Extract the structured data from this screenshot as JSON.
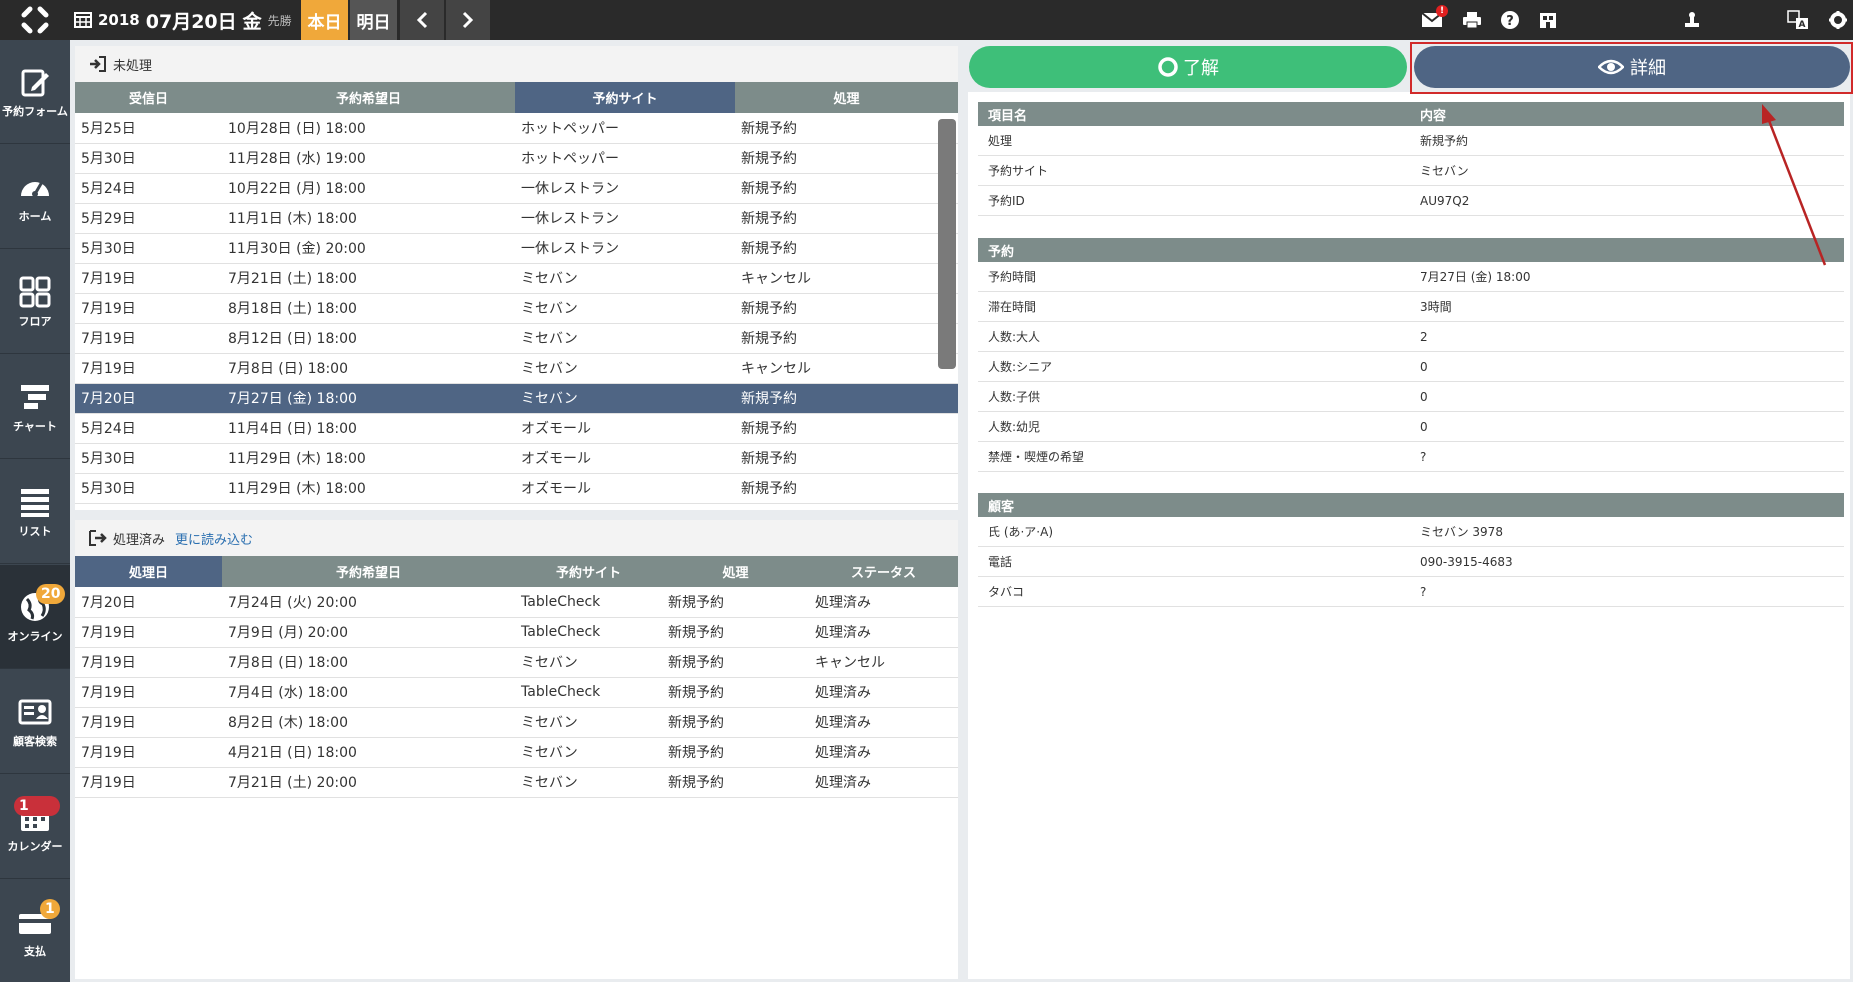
{
  "topbar": {
    "year": "2018",
    "month_day": "07月20日",
    "weekday": "金",
    "rokuyo": "先勝",
    "today_label": "本日",
    "tomorrow_label": "明日",
    "mail_badge": "!"
  },
  "sidebar": {
    "items": [
      {
        "label": "予約フォーム",
        "icon": "edit-form-icon"
      },
      {
        "label": "ホーム",
        "icon": "dashboard-icon"
      },
      {
        "label": "フロア",
        "icon": "floor-grid-icon"
      },
      {
        "label": "チャート",
        "icon": "chart-icon"
      },
      {
        "label": "リスト",
        "icon": "list-icon"
      },
      {
        "label": "オンライン",
        "icon": "globe-icon",
        "badge": "20"
      },
      {
        "label": "顧客検索",
        "icon": "customer-card-icon"
      },
      {
        "label": "カレンダー",
        "icon": "calendar-icon",
        "badge": "1"
      },
      {
        "label": "支払",
        "icon": "payment-card-icon",
        "badge": "1"
      }
    ]
  },
  "pending": {
    "title": "未処理",
    "columns": [
      "受信日",
      "予約希望日",
      "予約サイト",
      "処理"
    ],
    "rows": [
      [
        "5月25日",
        "10月28日 (日) 18:00",
        "ホットペッパー",
        "新規予約"
      ],
      [
        "5月30日",
        "11月28日 (水) 19:00",
        "ホットペッパー",
        "新規予約"
      ],
      [
        "5月24日",
        "10月22日 (月) 18:00",
        "一休レストラン",
        "新規予約"
      ],
      [
        "5月29日",
        "11月1日 (木) 18:00",
        "一休レストラン",
        "新規予約"
      ],
      [
        "5月30日",
        "11月30日 (金) 20:00",
        "一休レストラン",
        "新規予約"
      ],
      [
        "7月19日",
        "7月21日 (土) 18:00",
        "ミセバン",
        "キャンセル"
      ],
      [
        "7月19日",
        "8月18日 (土) 18:00",
        "ミセバン",
        "新規予約"
      ],
      [
        "7月19日",
        "8月12日 (日) 18:00",
        "ミセバン",
        "新規予約"
      ],
      [
        "7月19日",
        "7月8日 (日) 18:00",
        "ミセバン",
        "キャンセル"
      ],
      [
        "7月20日",
        "7月27日 (金) 18:00",
        "ミセバン",
        "新規予約"
      ],
      [
        "5月24日",
        "11月4日 (日) 18:00",
        "オズモール",
        "新規予約"
      ],
      [
        "5月30日",
        "11月29日 (木) 18:00",
        "オズモール",
        "新規予約"
      ],
      [
        "5月30日",
        "11月29日 (木) 18:00",
        "オズモール",
        "新規予約"
      ]
    ]
  },
  "processed": {
    "title": "処理済み",
    "load_more": "更に読み込む",
    "columns": [
      "処理日",
      "予約希望日",
      "予約サイト",
      "処理",
      "ステータス"
    ],
    "rows": [
      [
        "7月20日",
        "7月24日 (火) 20:00",
        "TableCheck",
        "新規予約",
        "処理済み"
      ],
      [
        "7月19日",
        "7月9日 (月) 20:00",
        "TableCheck",
        "新規予約",
        "処理済み"
      ],
      [
        "7月19日",
        "7月8日 (日) 18:00",
        "ミセバン",
        "新規予約",
        "キャンセル"
      ],
      [
        "7月19日",
        "7月4日 (水) 18:00",
        "TableCheck",
        "新規予約",
        "処理済み"
      ],
      [
        "7月19日",
        "8月2日 (木) 18:00",
        "ミセバン",
        "新規予約",
        "処理済み"
      ],
      [
        "7月19日",
        "4月21日 (日) 18:00",
        "ミセバン",
        "新規予約",
        "処理済み"
      ],
      [
        "7月19日",
        "7月21日 (土) 20:00",
        "ミセバン",
        "新規予約",
        "処理済み"
      ]
    ]
  },
  "actions": {
    "ok_label": "了解",
    "detail_label": "詳細"
  },
  "detail": {
    "header": [
      "項目名",
      "内容"
    ],
    "basic": [
      [
        "処理",
        "新規予約"
      ],
      [
        "予約サイト",
        "ミセバン"
      ],
      [
        "予約ID",
        "AU97Q2"
      ]
    ],
    "reservation_title": "予約",
    "reservation": [
      [
        "予約時間",
        "7月27日 (金) 18:00"
      ],
      [
        "滞在時間",
        "3時間"
      ],
      [
        "人数:大人",
        "2"
      ],
      [
        "人数:シニア",
        "0"
      ],
      [
        "人数:子供",
        "0"
      ],
      [
        "人数:幼児",
        "0"
      ],
      [
        "禁煙・喫煙の希望",
        "?"
      ]
    ],
    "customer_title": "顧客",
    "customer": [
      [
        "氏 (あ·ア·A)",
        "ミセバン 3978"
      ],
      [
        "電話",
        "090-3915-4683"
      ],
      [
        "タバコ",
        "?"
      ]
    ]
  },
  "colors": {
    "accent_orange": "#f0a83a",
    "selected_row": "#4f6584",
    "header_gray": "#7d8c8a",
    "ok_green": "#3ebf79",
    "annotation_red": "#d12a2a"
  }
}
